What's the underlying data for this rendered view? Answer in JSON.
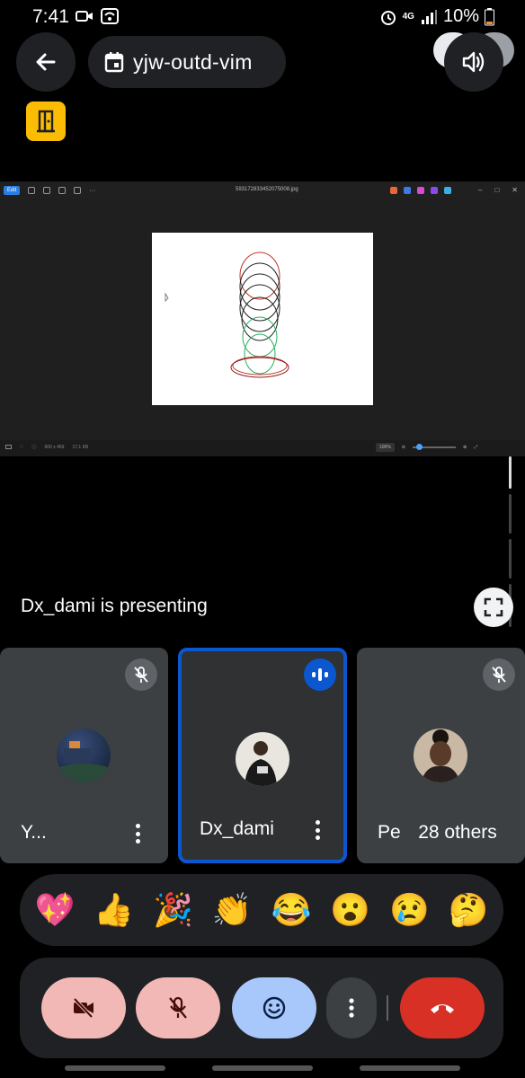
{
  "status_bar": {
    "time": "7:41",
    "network": "4G",
    "battery": "10%",
    "icons": [
      "video-record-icon",
      "wifi-icon",
      "alarm-icon",
      "signal-icon",
      "battery-icon"
    ]
  },
  "header": {
    "meeting_code": "yjw-outd-vim",
    "icons": [
      "back-arrow-icon",
      "calendar-icon",
      "speaker-icon",
      "door-icon"
    ]
  },
  "presentation": {
    "filename": "593172833452075008.jpg",
    "edit_label": "Edit",
    "image_dims": "600 x 469",
    "file_size": "17.1 KB",
    "zoom": "100%",
    "presenter_text": "Dx_dami is presenting"
  },
  "participants": [
    {
      "name": "Y...",
      "muted": true
    },
    {
      "name": "Dx_dami",
      "speaking": true
    },
    {
      "name": "Pea",
      "muted": true
    }
  ],
  "others_label": "28 others",
  "reactions": [
    "💖",
    "👍",
    "🎉",
    "👏",
    "😂",
    "😮",
    "😢",
    "🤔"
  ],
  "controls": {
    "accent": "#a8c7fa",
    "muted_bg": "#f2b8b5",
    "end_bg": "#d93025"
  }
}
